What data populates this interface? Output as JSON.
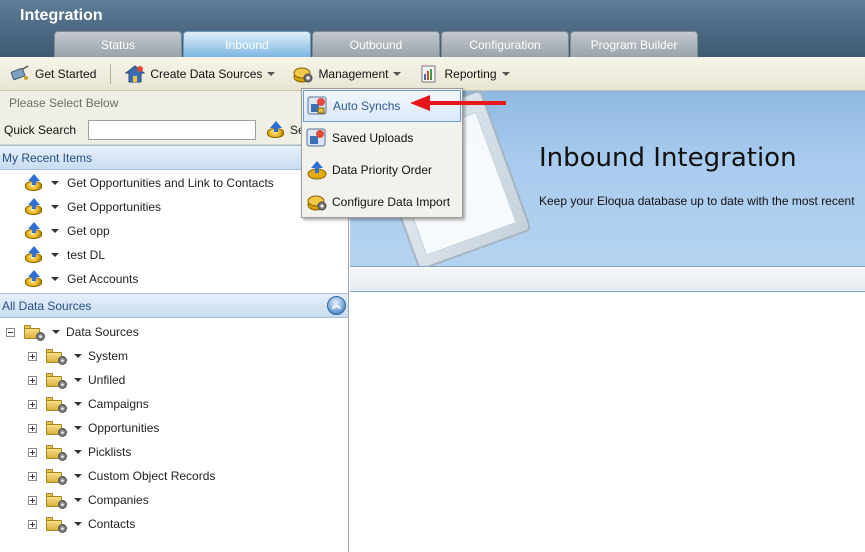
{
  "app": {
    "title": "Integration"
  },
  "tabs": [
    {
      "label": "Status",
      "active": false
    },
    {
      "label": "Inbound",
      "active": true
    },
    {
      "label": "Outbound",
      "active": false
    },
    {
      "label": "Configuration",
      "active": false
    },
    {
      "label": "Program Builder",
      "active": false
    }
  ],
  "toolbar": {
    "get_started": "Get Started",
    "create_data_sources": "Create Data Sources",
    "management": "Management",
    "reporting": "Reporting"
  },
  "left": {
    "select_prompt": "Please Select Below",
    "quick_search_label": "Quick Search",
    "quick_search_value": "",
    "quick_search_button": "Se",
    "recent_header": "My Recent Items",
    "recent_items": [
      "Get Opportunities and Link to Contacts",
      "Get Opportunities",
      "Get opp",
      "test DL",
      "Get Accounts"
    ],
    "all_sources_header": "All Data Sources",
    "tree_root": "Data Sources",
    "tree_children": [
      "System",
      "Unfiled",
      "Campaigns",
      "Opportunities",
      "Picklists",
      "Custom Object Records",
      "Companies",
      "Contacts"
    ]
  },
  "menu": {
    "items": [
      {
        "label": "Auto Synchs",
        "icon": "auto-synch-icon",
        "highlighted": true
      },
      {
        "label": "Saved Uploads",
        "icon": "saved-uploads-icon",
        "highlighted": false
      },
      {
        "label": "Data Priority Order",
        "icon": "upload-arrow-icon",
        "highlighted": false
      },
      {
        "label": "Configure Data Import",
        "icon": "gold-data-icon",
        "highlighted": false
      }
    ]
  },
  "main": {
    "title": "Inbound Integration",
    "subtitle": "Keep your Eloqua database up to date with the most recent"
  },
  "colors": {
    "header": "#4a6680",
    "accent_blue": "#2a4f80",
    "banner": "#a9cbee",
    "annotation_arrow": "#e8161b"
  }
}
